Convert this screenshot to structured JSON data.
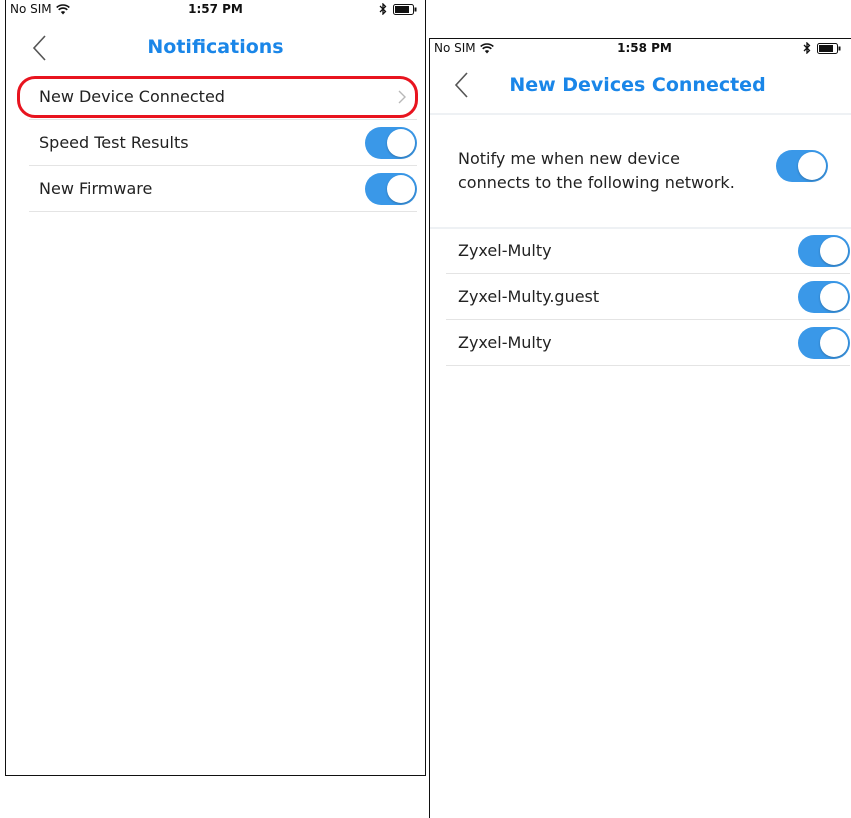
{
  "screen1": {
    "status": {
      "carrier": "No SIM",
      "time": "1:57 PM"
    },
    "title": "Notifications",
    "items": [
      {
        "label": "New Device Connected"
      },
      {
        "label": "Speed Test Results",
        "enabled": true
      },
      {
        "label": "New Firmware",
        "enabled": true
      }
    ]
  },
  "screen2": {
    "status": {
      "carrier": "No SIM",
      "time": "1:58 PM"
    },
    "title": "New Devices Connected",
    "notify": {
      "line1": "Notify me when new device",
      "line2": "connects to the following network.",
      "enabled": true
    },
    "networks": [
      {
        "label": "Zyxel-Multy",
        "enabled": true
      },
      {
        "label": "Zyxel-Multy.guest",
        "enabled": true
      },
      {
        "label": "Zyxel-Multy",
        "enabled": true
      }
    ]
  },
  "colors": {
    "accent": "#1a86e8",
    "toggle_on": "#3a98e8",
    "highlight": "#e8141f"
  }
}
